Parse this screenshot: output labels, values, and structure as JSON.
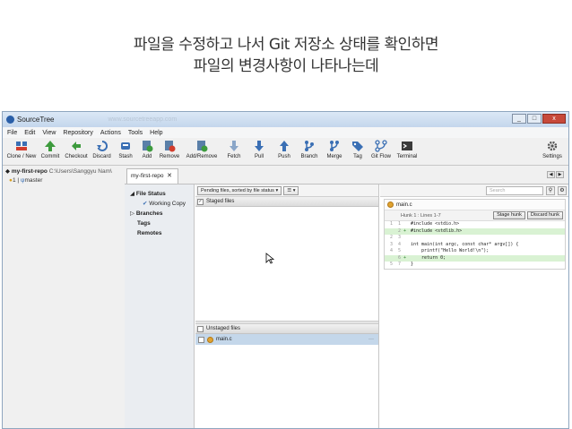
{
  "slide": {
    "title_line1": "파일을 수정하고 나서 Git 저장소 상태를 확인하면",
    "title_line2": "파일의 변경사항이 나타나는데"
  },
  "window": {
    "title": "SourceTree",
    "faded_title": "www.sourcetreeapp.com",
    "minimize": "_",
    "maximize": "□",
    "close": "x"
  },
  "menu": [
    "File",
    "Edit",
    "View",
    "Repository",
    "Actions",
    "Tools",
    "Help"
  ],
  "toolbar": {
    "buttons": [
      {
        "label": "Clone / New",
        "icon": "clone-icon"
      },
      {
        "label": "Commit",
        "icon": "commit-icon"
      },
      {
        "label": "Checkout",
        "icon": "checkout-icon"
      },
      {
        "label": "Discard",
        "icon": "discard-icon"
      },
      {
        "label": "Stash",
        "icon": "stash-icon"
      },
      {
        "label": "Add",
        "icon": "add-icon"
      },
      {
        "label": "Remove",
        "icon": "remove-icon"
      },
      {
        "label": "Add/Remove",
        "icon": "add-remove-icon"
      },
      {
        "label": "Fetch",
        "icon": "fetch-icon"
      },
      {
        "label": "Pull",
        "icon": "pull-icon"
      },
      {
        "label": "Push",
        "icon": "push-icon"
      },
      {
        "label": "Branch",
        "icon": "branch-icon"
      },
      {
        "label": "Merge",
        "icon": "merge-icon"
      },
      {
        "label": "Tag",
        "icon": "tag-icon"
      },
      {
        "label": "Git Flow",
        "icon": "git-flow-icon"
      },
      {
        "label": "Terminal",
        "icon": "terminal-icon"
      }
    ],
    "settings_label": "Settings"
  },
  "repo": {
    "name": "my-first-repo",
    "path": "C:\\Users\\Sanggyu Nam\\",
    "status": "1 | ",
    "branch": "master",
    "tab_label": "my-first-repo",
    "tab_close": "✕"
  },
  "sidebar": {
    "file_status": "File Status",
    "working_copy": "Working Copy",
    "branches": "Branches",
    "tags": "Tags",
    "remotes": "Remotes"
  },
  "files": {
    "sort_dropdown": "Pending files, sorted by file status",
    "view_dropdown": "☰ ▾",
    "staged_header": "Staged files",
    "unstaged_header": "Unstaged files",
    "unstaged_items": [
      {
        "name": "main.c",
        "more": "···"
      }
    ]
  },
  "diff": {
    "search_placeholder": "Search",
    "file_name": "main.c",
    "hunk_label": "Hunk 1 : Lines 1-7",
    "stage_hunk": "Stage hunk",
    "discard_hunk": "Discard hunk",
    "lines": [
      {
        "old": "1",
        "new": "1",
        "mark": "",
        "text": "#include <stdio.h>",
        "added": false
      },
      {
        "old": "",
        "new": "2",
        "mark": "+",
        "text": "#include <stdlib.h>",
        "added": true
      },
      {
        "old": "2",
        "new": "3",
        "mark": "",
        "text": "",
        "added": false
      },
      {
        "old": "3",
        "new": "4",
        "mark": "",
        "text": "int main(int argc, const char* argv[]) {",
        "added": false
      },
      {
        "old": "4",
        "new": "5",
        "mark": "",
        "text": "    printf(\"Hello World!\\n\");",
        "added": false
      },
      {
        "old": "",
        "new": "6",
        "mark": "+",
        "text": "    return 0;",
        "added": true
      },
      {
        "old": "5",
        "new": "7",
        "mark": "",
        "text": "}",
        "added": false
      }
    ]
  }
}
